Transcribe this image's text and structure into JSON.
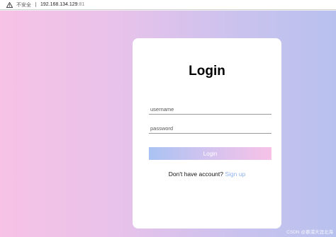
{
  "browser": {
    "insecure_label": "不安全",
    "url_host": "192.168.134.129",
    "url_port": ":81"
  },
  "login": {
    "title": "Login",
    "username_placeholder": "username",
    "password_placeholder": "password",
    "button_label": "Login",
    "prompt_text": "Don't have account?",
    "signup_link": "Sign up"
  },
  "colors": {
    "gradient_left": "#f7c2e6",
    "gradient_right": "#b8c1ee",
    "button_left": "#a9c3f2",
    "button_right": "#f7c2e7",
    "link": "#8fb2ee"
  },
  "watermark": "CSDN @慕浦天涯北海"
}
